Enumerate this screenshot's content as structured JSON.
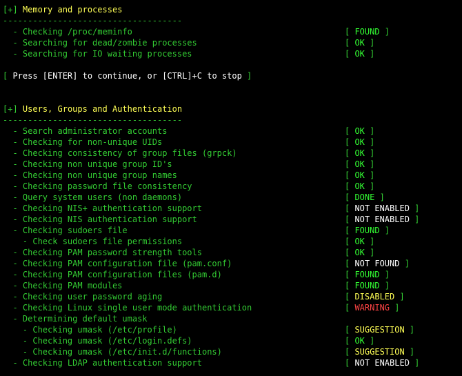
{
  "sections": [
    {
      "title": "Memory and processes",
      "divider": "------------------------------------",
      "checks": [
        {
          "label": "  - Checking /proc/meminfo",
          "status": "FOUND",
          "color": "#33ff33"
        },
        {
          "label": "  - Searching for dead/zombie processes",
          "status": "OK",
          "color": "#33ff33"
        },
        {
          "label": "  - Searching for IO waiting processes",
          "status": "OK",
          "color": "#33ff33"
        }
      ]
    },
    {
      "title": "Users, Groups and Authentication",
      "divider": "------------------------------------",
      "checks": [
        {
          "label": "  - Search administrator accounts",
          "status": "OK",
          "color": "#33ff33"
        },
        {
          "label": "  - Checking for non-unique UIDs",
          "status": "OK",
          "color": "#33ff33"
        },
        {
          "label": "  - Checking consistency of group files (grpck)",
          "status": "OK",
          "color": "#33ff33"
        },
        {
          "label": "  - Checking non unique group ID's",
          "status": "OK",
          "color": "#33ff33"
        },
        {
          "label": "  - Checking non unique group names",
          "status": "OK",
          "color": "#33ff33"
        },
        {
          "label": "  - Checking password file consistency",
          "status": "OK",
          "color": "#33ff33"
        },
        {
          "label": "  - Query system users (non daemons)",
          "status": "DONE",
          "color": "#33ff33"
        },
        {
          "label": "  - Checking NIS+ authentication support",
          "status": "NOT ENABLED",
          "color": "#ffffff"
        },
        {
          "label": "  - Checking NIS authentication support",
          "status": "NOT ENABLED",
          "color": "#ffffff"
        },
        {
          "label": "  - Checking sudoers file",
          "status": "FOUND",
          "color": "#33ff33"
        },
        {
          "label": "    - Check sudoers file permissions",
          "status": "OK",
          "color": "#33ff33"
        },
        {
          "label": "  - Checking PAM password strength tools",
          "status": "OK",
          "color": "#33ff33"
        },
        {
          "label": "  - Checking PAM configuration file (pam.conf)",
          "status": "NOT FOUND",
          "color": "#ffffff"
        },
        {
          "label": "  - Checking PAM configuration files (pam.d)",
          "status": "FOUND",
          "color": "#33ff33"
        },
        {
          "label": "  - Checking PAM modules",
          "status": "FOUND",
          "color": "#33ff33"
        },
        {
          "label": "  - Checking user password aging",
          "status": "DISABLED",
          "color": "#ffff55"
        },
        {
          "label": "  - Checking Linux single user mode authentication",
          "status": "WARNING",
          "color": "#ff4444"
        },
        {
          "label": "  - Determining default umask",
          "status": null,
          "color": null
        },
        {
          "label": "    - Checking umask (/etc/profile)",
          "status": "SUGGESTION",
          "color": "#ffff55"
        },
        {
          "label": "    - Checking umask (/etc/login.defs)",
          "status": "OK",
          "color": "#33ff33"
        },
        {
          "label": "    - Checking umask (/etc/init.d/functions)",
          "status": "SUGGESTION",
          "color": "#ffff55"
        },
        {
          "label": "  - Checking LDAP authentication support",
          "status": "NOT ENABLED",
          "color": "#ffffff"
        }
      ]
    }
  ],
  "prompt": {
    "text": " Press [ENTER] to continue, or [CTRL]+C to stop "
  },
  "section_prefix": "[+]",
  "colors": {
    "background": "#000000",
    "label": "#33cc33",
    "title": "#ffff55"
  }
}
